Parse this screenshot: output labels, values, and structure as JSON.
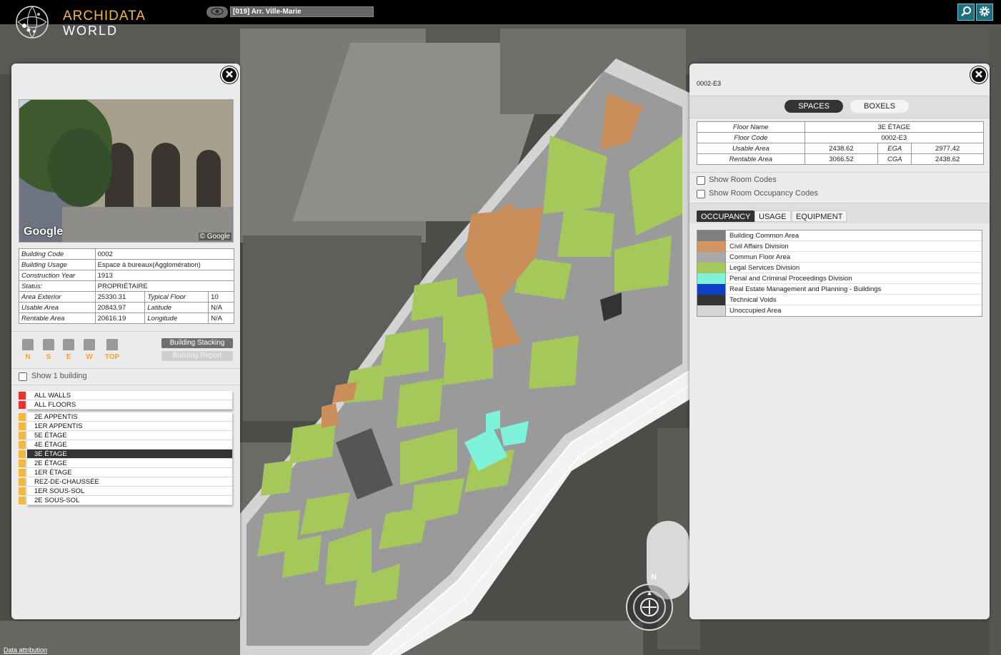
{
  "header": {
    "app_title": "ARCHIDATA",
    "app_subtitle": "WORLD",
    "location_value": "[019] Arr. Ville-Marie",
    "icons": {
      "visibility": "eye-icon",
      "search": "search-icon",
      "settings": "gear-icon"
    }
  },
  "building_panel": {
    "close_icon": "close-icon",
    "photo": {
      "provider_logo": "Google",
      "copyright": "© Google"
    },
    "details": {
      "building_code_label": "Building Code",
      "building_code": "0002",
      "building_usage_label": "Building Usage",
      "building_usage": "Espace à bureaux(Agglomération)",
      "construction_year_label": "Construction Year",
      "construction_year": "1913",
      "status_label": "Status:",
      "status": "PROPRIÉTAIRE",
      "area_exterior_label": "Area Exterior",
      "area_exterior": "25330.31",
      "typical_floor_label": "Typical Floor",
      "typical_floor": "10",
      "usable_area_label": "Usable Area",
      "usable_area": "20843.97",
      "latitude_label": "Latitude",
      "latitude": "N/A",
      "rentable_area_label": "Rentable Area",
      "rentable_area": "20616.19",
      "longitude_label": "Longitude",
      "longitude": "N/A"
    },
    "view_directions": [
      "N",
      "S",
      "E",
      "W",
      "TOP"
    ],
    "building_stacking_label": "Building Stacking",
    "building_report_label": "Building Report",
    "show_one_building_label": "Show 1 building",
    "layers": [
      {
        "label": "ALL WALLS",
        "color": "#e8332f"
      },
      {
        "label": "ALL FLOORS",
        "color": "#e8332f"
      }
    ],
    "floors": [
      {
        "label": "2E APPENTIS",
        "color": "#f6b83c"
      },
      {
        "label": "1ER APPENTIS",
        "color": "#f6b83c"
      },
      {
        "label": "5E ÉTAGE",
        "color": "#f6b83c"
      },
      {
        "label": "4E ÉTAGE",
        "color": "#f6b83c"
      },
      {
        "label": "3E ÉTAGE",
        "color": "#f6b83c"
      },
      {
        "label": "2E ÉTAGE",
        "color": "#f6b83c"
      },
      {
        "label": "1ER ÉTAGE",
        "color": "#f6b83c"
      },
      {
        "label": "REZ-DE-CHAUSSÉE",
        "color": "#f6b83c"
      },
      {
        "label": "1ER SOUS-SOL",
        "color": "#f6b83c"
      },
      {
        "label": "2E SOUS-SOL",
        "color": "#f6b83c"
      }
    ],
    "selected_floor": "3E ÉTAGE"
  },
  "floor_panel": {
    "close_icon": "close-icon",
    "floor_code_title": "0002-E3",
    "tabs": {
      "spaces": "SPACES",
      "boxels": "BOXELS"
    },
    "floor_table": {
      "floor_name_label": "Floor Name",
      "floor_name": "3E ÉTAGE",
      "floor_code_label": "Floor Code",
      "floor_code": "0002-E3",
      "usable_area_label": "Usable Area",
      "usable_area": "2438.62",
      "ega_label": "EGA",
      "ega": "2977.42",
      "rentable_area_label": "Rentable Area",
      "rentable_area": "3066.52",
      "cga_label": "CGA",
      "cga": "2438.62"
    },
    "show_room_codes_label": "Show Room Codes",
    "show_room_occupancy_label": "Show Room Occupancy Codes",
    "legend_tabs": {
      "occupancy": "OCCUPANCY",
      "usage": "USAGE",
      "equipment": "EQUIPMENT"
    },
    "legend": [
      {
        "label": "Building Common Area",
        "color": "#7f7f7f"
      },
      {
        "label": "Civil Affairs Division",
        "color": "#d2955f"
      },
      {
        "label": "Commun Floor Area",
        "color": "#a9a9a9"
      },
      {
        "label": "Legal Services Division",
        "color": "#a4c95a"
      },
      {
        "label": "Penal and Criminal Proceedings Division",
        "color": "#7ff2dc"
      },
      {
        "label": "Real Estate Management and Planning - Buildings",
        "color": "#0f3fc9"
      },
      {
        "label": "Technical Voids",
        "color": "#333333"
      },
      {
        "label": "Unoccupied Area",
        "color": "#d6d6d6"
      }
    ]
  },
  "map": {
    "compass_label": "N",
    "attribution_label": "Data attribution"
  }
}
